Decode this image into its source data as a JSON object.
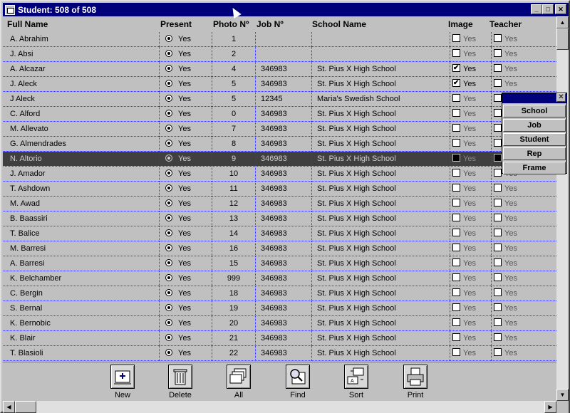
{
  "window": {
    "title": "Student: 508 of 508",
    "minimize": "_",
    "maximize": "□",
    "close": "✕"
  },
  "columns": {
    "full_name": "Full Name",
    "present": "Present",
    "photo": "Photo Nº",
    "job": "Job Nº",
    "school": "School Name",
    "image": "Image",
    "teacher": "Teacher"
  },
  "yes": "Yes",
  "rows": [
    {
      "name": "A. Abrahim",
      "photo": "1",
      "job": "",
      "school": "",
      "image": false,
      "teacher": false,
      "image_muted": true
    },
    {
      "name": "J. Absi",
      "photo": "2",
      "job": "",
      "school": "",
      "image": false,
      "teacher": false,
      "image_muted": true
    },
    {
      "name": "A. Alcazar",
      "photo": "4",
      "job": "346983",
      "school": "St. Pius X High School",
      "image": true,
      "teacher": false
    },
    {
      "name": "J. Aleck",
      "photo": "5",
      "job": "346983",
      "school": "St. Pius X High School",
      "image": true,
      "teacher": false
    },
    {
      "name": "J Aleck",
      "photo": "5",
      "job": "12345",
      "school": "Maria's Swedish School",
      "image": false,
      "teacher": false
    },
    {
      "name": "C. Alford",
      "photo": "0",
      "job": "346983",
      "school": "St. Pius X High School",
      "image": false,
      "teacher": false
    },
    {
      "name": "M. Allevato",
      "photo": "7",
      "job": "346983",
      "school": "St. Pius X High School",
      "image": false,
      "teacher": false
    },
    {
      "name": "G. Almendrades",
      "photo": "8",
      "job": "346983",
      "school": "St. Pius X High School",
      "image": false,
      "teacher": false
    },
    {
      "name": "N. Altorio",
      "photo": "9",
      "job": "346983",
      "school": "St. Pius X High School",
      "image": false,
      "teacher": false,
      "selected": true
    },
    {
      "name": "J. Amador",
      "photo": "10",
      "job": "346983",
      "school": "St. Pius X High School",
      "image": false,
      "teacher": false
    },
    {
      "name": "T. Ashdown",
      "photo": "11",
      "job": "346983",
      "school": "St. Pius X High School",
      "image": false,
      "teacher": false
    },
    {
      "name": "M. Awad",
      "photo": "12",
      "job": "346983",
      "school": "St. Pius X High School",
      "image": false,
      "teacher": false
    },
    {
      "name": "B.  Baassiri",
      "photo": "13",
      "job": "346983",
      "school": "St. Pius X High School",
      "image": false,
      "teacher": false
    },
    {
      "name": "T. Balice",
      "photo": "14",
      "job": "346983",
      "school": "St. Pius X High School",
      "image": false,
      "teacher": false
    },
    {
      "name": "M. Barresi",
      "photo": "16",
      "job": "346983",
      "school": "St. Pius X High School",
      "image": false,
      "teacher": false
    },
    {
      "name": "A. Barresi",
      "photo": "15",
      "job": "346983",
      "school": "St. Pius X High School",
      "image": false,
      "teacher": false
    },
    {
      "name": "K. Belchamber",
      "photo": "999",
      "job": "346983",
      "school": "St. Pius X High School",
      "image": false,
      "teacher": false
    },
    {
      "name": "C. Bergin",
      "photo": "18",
      "job": "346983",
      "school": "St. Pius X High School",
      "image": false,
      "teacher": false
    },
    {
      "name": "S. Bernal",
      "photo": "19",
      "job": "346983",
      "school": "St. Pius X High School",
      "image": false,
      "teacher": false
    },
    {
      "name": "K. Bernobic",
      "photo": "20",
      "job": "346983",
      "school": "St. Pius X High School",
      "image": false,
      "teacher": false
    },
    {
      "name": "K. Blair",
      "photo": "21",
      "job": "346983",
      "school": "St. Pius X High School",
      "image": false,
      "teacher": false
    },
    {
      "name": "T. Blasioli",
      "photo": "22",
      "job": "346983",
      "school": "St. Pius X High School",
      "image": false,
      "teacher": false
    }
  ],
  "popup": {
    "close": "✕",
    "items": [
      "School",
      "Job",
      "Student",
      "Rep",
      "Frame"
    ]
  },
  "toolbar": [
    {
      "label": "New",
      "icon": "new-record-icon"
    },
    {
      "label": "Delete",
      "icon": "trash-icon"
    },
    {
      "label": "All",
      "icon": "stack-icon"
    },
    {
      "label": "Find",
      "icon": "find-icon"
    },
    {
      "label": "Sort",
      "icon": "sort-icon"
    },
    {
      "label": "Print",
      "icon": "printer-icon"
    }
  ],
  "scroll": {
    "up": "▲",
    "down": "▼",
    "left": "◀",
    "right": "▶"
  }
}
